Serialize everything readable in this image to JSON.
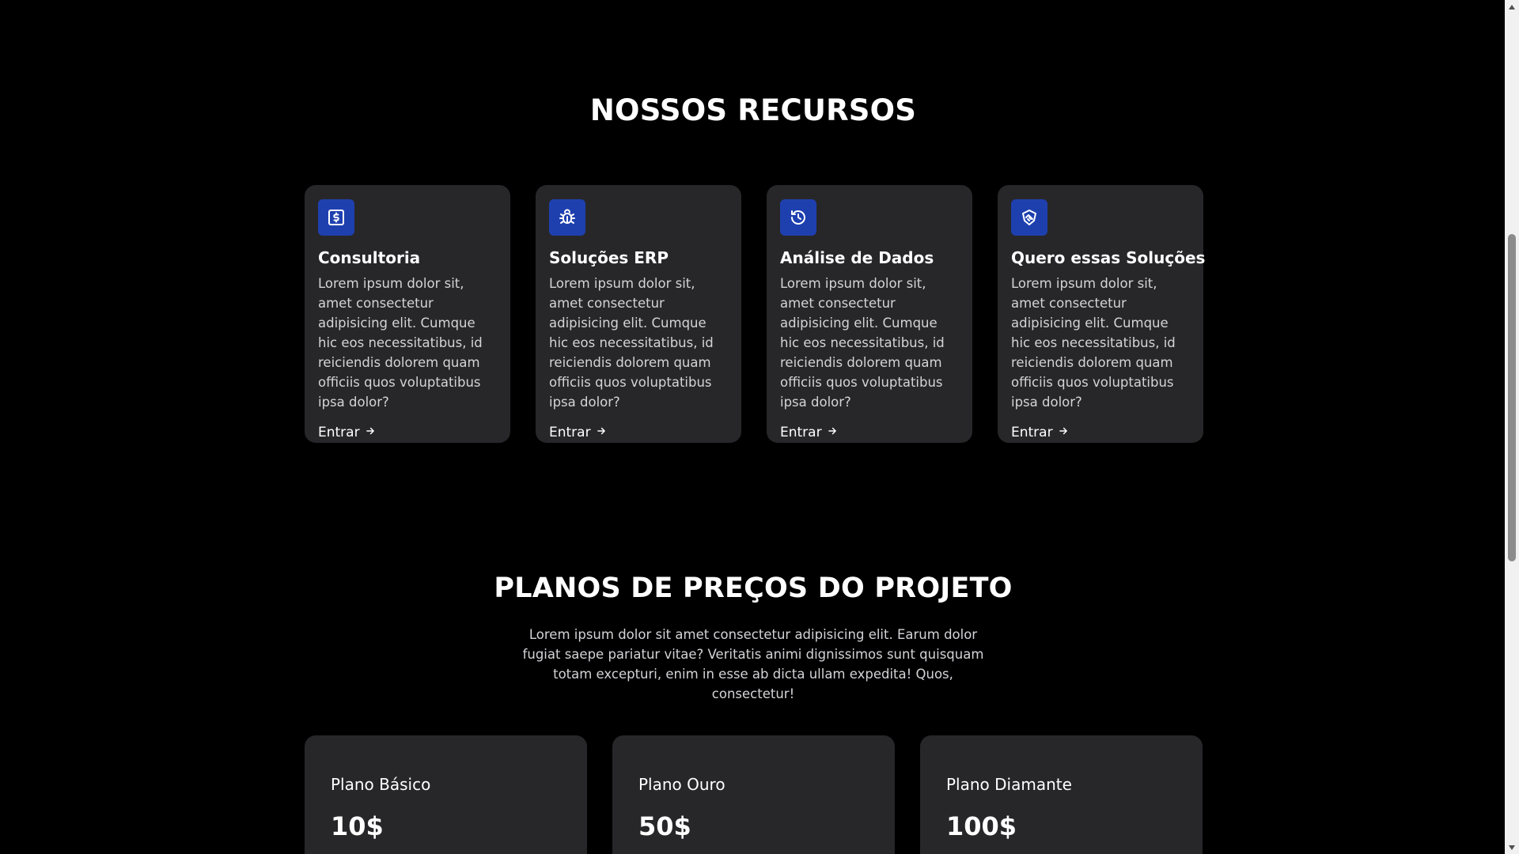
{
  "colors": {
    "background": "#000000",
    "card": "#27272a",
    "accent": "#1e40af",
    "text": "#ffffff",
    "muted_text": "#d4d4d8"
  },
  "features": {
    "title": "NOSSOS RECURSOS",
    "cards": [
      {
        "icon": "dollar-sign-icon",
        "title": "Consultoria",
        "text": "Lorem ipsum dolor sit, amet consectetur adipisicing elit. Cumque hic eos necessitatibus, id reiciendis dolorem quam officiis quos voluptatibus ipsa dolor?",
        "link": "Entrar"
      },
      {
        "icon": "bug-icon",
        "title": "Soluções ERP",
        "text": "Lorem ipsum dolor sit, amet consectetur adipisicing elit. Cumque hic eos necessitatibus, id reiciendis dolorem quam officiis quos voluptatibus ipsa dolor?",
        "link": "Entrar"
      },
      {
        "icon": "history-icon",
        "title": "Análise de Dados",
        "text": "Lorem ipsum dolor sit, amet consectetur adipisicing elit. Cumque hic eos necessitatibus, id reiciendis dolorem quam officiis quos voluptatibus ipsa dolor?",
        "link": "Entrar"
      },
      {
        "icon": "handshake-icon",
        "title": "Quero essas Soluções",
        "text": "Lorem ipsum dolor sit, amet consectetur adipisicing elit. Cumque hic eos necessitatibus, id reiciendis dolorem quam officiis quos voluptatibus ipsa dolor?",
        "link": "Entrar"
      }
    ]
  },
  "pricing": {
    "title": "PLANOS DE PREÇOS DO PROJETO",
    "description": "Lorem ipsum dolor sit amet consectetur adipisicing elit. Earum dolor fugiat saepe pariatur vitae? Veritatis animi dignissimos sunt quisquam totam excepturi, enim in esse ab dicta ullam expedita! Quos, consectetur!",
    "plans": [
      {
        "name": "Plano Básico",
        "price": "10$"
      },
      {
        "name": "Plano Ouro",
        "price": "50$"
      },
      {
        "name": "Plano Diamante",
        "price": "100$"
      }
    ]
  }
}
